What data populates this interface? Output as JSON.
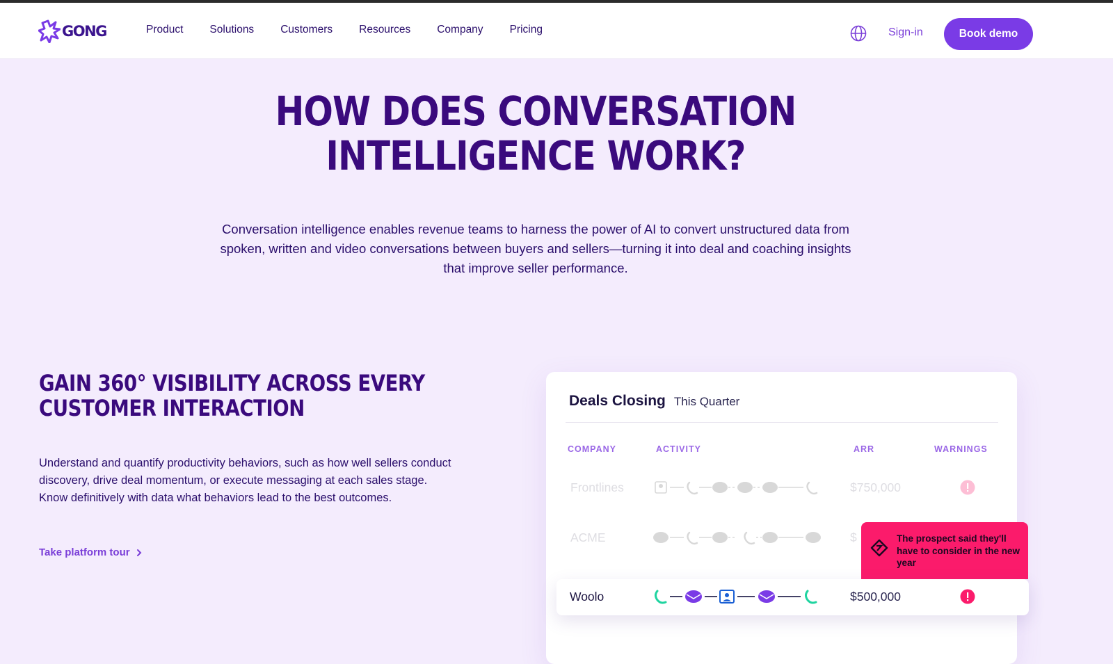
{
  "nav": {
    "logo_text": "GONG",
    "links": [
      {
        "label": "Product"
      },
      {
        "label": "Solutions"
      },
      {
        "label": "Customers"
      },
      {
        "label": "Resources"
      },
      {
        "label": "Company"
      },
      {
        "label": "Pricing"
      }
    ],
    "globe_icon": "globe-icon",
    "signin_label": "Sign-in",
    "cta_label": "Book demo"
  },
  "hero": {
    "title_line1": "HOW DOES CONVERSATION",
    "title_line2": "INTELLIGENCE WORK?",
    "subtitle": "Conversation intelligence enables revenue teams to harness the power of AI to convert unstructured data from spoken, written and video conversations between buyers and sellers—turning it into deal and coaching insights that improve seller performance."
  },
  "feature": {
    "title_line1": "GAIN 360° VISIBILITY ACROSS EVERY",
    "title_line2": "CUSTOMER INTERACTION",
    "body": "Understand and quantify productivity behaviors, such as how well sellers conduct discovery, drive deal momentum, or execute messaging at each sales stage. Know definitively with data what behaviors lead to the best outcomes.",
    "link_label": "Take platform tour"
  },
  "deals_card": {
    "title": "Deals Closing",
    "period": "This Quarter",
    "columns": {
      "company": "COMPANY",
      "activity": "ACTIVITY",
      "arr": "ARR",
      "warnings": "WARNINGS"
    },
    "rows": [
      {
        "company": "Frontlines",
        "arr": "$750,000",
        "activity": [
          "video",
          "call",
          "email",
          "email",
          "email",
          "call"
        ]
      },
      {
        "company": "ACME",
        "arr": "$",
        "activity": [
          "email",
          "call",
          "email",
          "call",
          "email",
          "email"
        ]
      },
      {
        "company": "Woolo",
        "arr": "$500,000",
        "activity": [
          "call",
          "email",
          "video",
          "email",
          "call"
        ]
      }
    ],
    "tooltip_text": "The prospect said they'll have to consider in the new year",
    "colors": {
      "accent": "#7a3be6",
      "warning": "#fb1b6b",
      "call": "#1fd4a0",
      "email": "#7a3be6"
    }
  }
}
